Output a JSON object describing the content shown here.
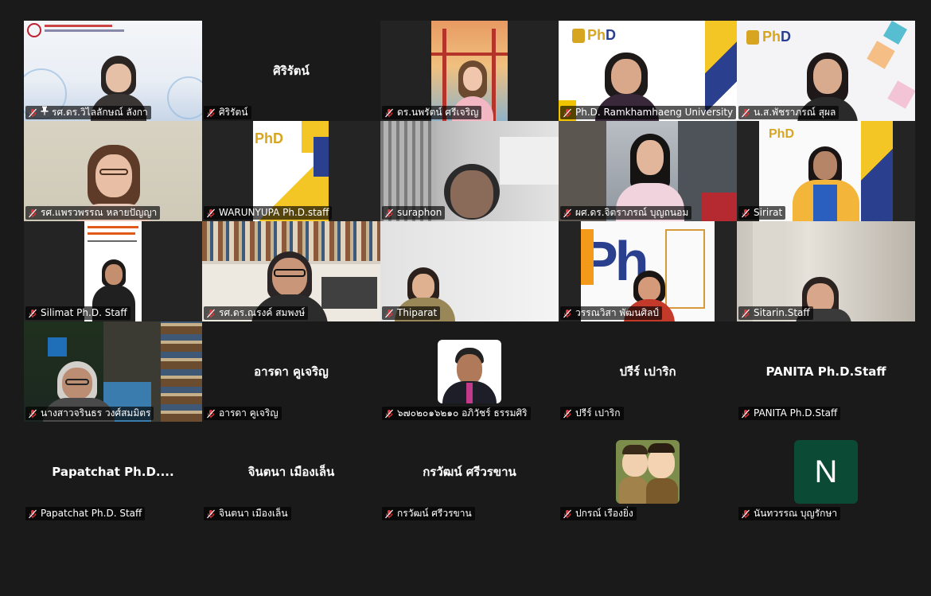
{
  "colors": {
    "background": "#1a1a1a",
    "tile": "#242424",
    "active_border": "#4fd07a",
    "mic_off": "#e0383e"
  },
  "tiles": [
    {
      "label": "รศ.ดร.วิไลลักษณ์ ลังกา",
      "pinned": true
    },
    {
      "label": "ศิริรัตน์",
      "center": "ศิริรัตน์"
    },
    {
      "label": "ดร.นพรัตน์ ศรีเจริญ"
    },
    {
      "label": "Ph.D. Ramkhamhaeng University"
    },
    {
      "label": "น.ส.พัชราภรณ์ สุผล"
    },
    {
      "label": "รศ.แพรวพรรณ หลายปัญญา",
      "active": true
    },
    {
      "label": "WARUNYUPA Ph.D.staff"
    },
    {
      "label": "suraphon"
    },
    {
      "label": "ผศ.ดร.จิตราภรณ์ บุญถนอม"
    },
    {
      "label": "Sirirat"
    },
    {
      "label": "Silimat Ph.D. Staff"
    },
    {
      "label": "รศ.ดร.ณรงค์ สมพงษ์"
    },
    {
      "label": "Thiparat"
    },
    {
      "label": "วรรณวิสา พัฒนศิลป์"
    },
    {
      "label": "Sitarin.Staff"
    },
    {
      "label": "นางสาวจรินธร วงศ์สมมิตร"
    },
    {
      "label": "อารดา คูเจริญ",
      "center": "อารดา คูเจริญ"
    },
    {
      "label": "๖๗๐๒๐๑๖๒๑๐ อภิวัชร์ ธรรมศิริ",
      "avatar": "photo"
    },
    {
      "label": "ปรีร์ เปาริก",
      "center": "ปรีร์ เปาริก"
    },
    {
      "label": "PANITA Ph.D.Staff",
      "center": "PANITA Ph.D.Staff"
    },
    {
      "label": "Papatchat Ph.D. Staff",
      "center": "Papatchat  Ph.D...."
    },
    {
      "label": "จินตนา  เมืองเล็น",
      "center": "จินตนา  เมืองเล็น"
    },
    {
      "label": "กรวัฒน์ ศรีวรขาน",
      "center": "กรวัฒน์ ศรีวรขาน"
    },
    {
      "label": "ปกรณ์ เรืองยิ่ง",
      "avatar": "cartoon"
    },
    {
      "label": "นันทวรรณ บุญรักษา",
      "avatar_letter": "N"
    }
  ]
}
